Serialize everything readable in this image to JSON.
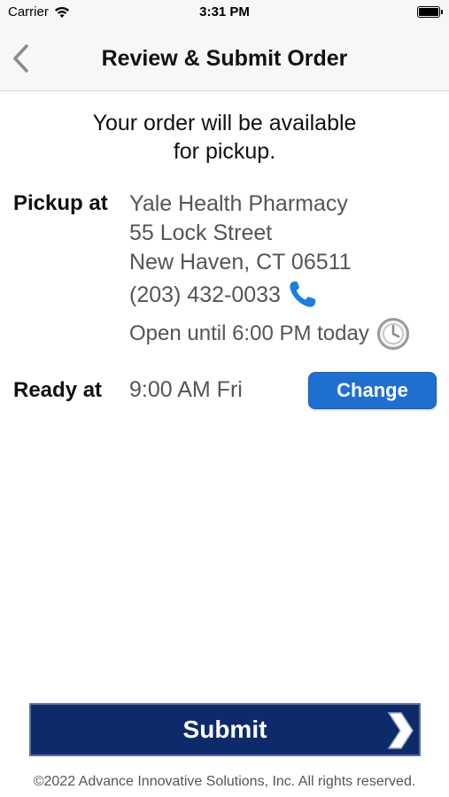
{
  "status_bar": {
    "carrier": "Carrier",
    "time": "3:31 PM",
    "icons": [
      "wifi-icon",
      "battery-icon"
    ]
  },
  "nav": {
    "title": "Review & Submit Order",
    "back_icon": "chevron-left-icon"
  },
  "intro": {
    "line1": "Your order will be available",
    "line2": "for pickup."
  },
  "pickup": {
    "label": "Pickup at",
    "name": "Yale Health Pharmacy",
    "street": "55 Lock Street",
    "city": "New Haven, CT 06511",
    "phone": "(203) 432-0033",
    "hours": "Open until 6:00 PM today",
    "phone_icon": "phone-icon",
    "hours_icon": "clock-icon"
  },
  "ready": {
    "label": "Ready at",
    "time": "9:00 AM Fri",
    "change_label": "Change"
  },
  "submit": {
    "label": "Submit",
    "arrow_icon": "chevron-right-icon"
  },
  "footer": {
    "copyright": "©2022 Advance Innovative Solutions, Inc. All rights reserved."
  },
  "colors": {
    "primary_button": "#1f6fd1",
    "submit_background": "#0d2b6b",
    "phone_icon": "#1a7fe0",
    "label_text": "#111111",
    "value_text": "#555555"
  }
}
